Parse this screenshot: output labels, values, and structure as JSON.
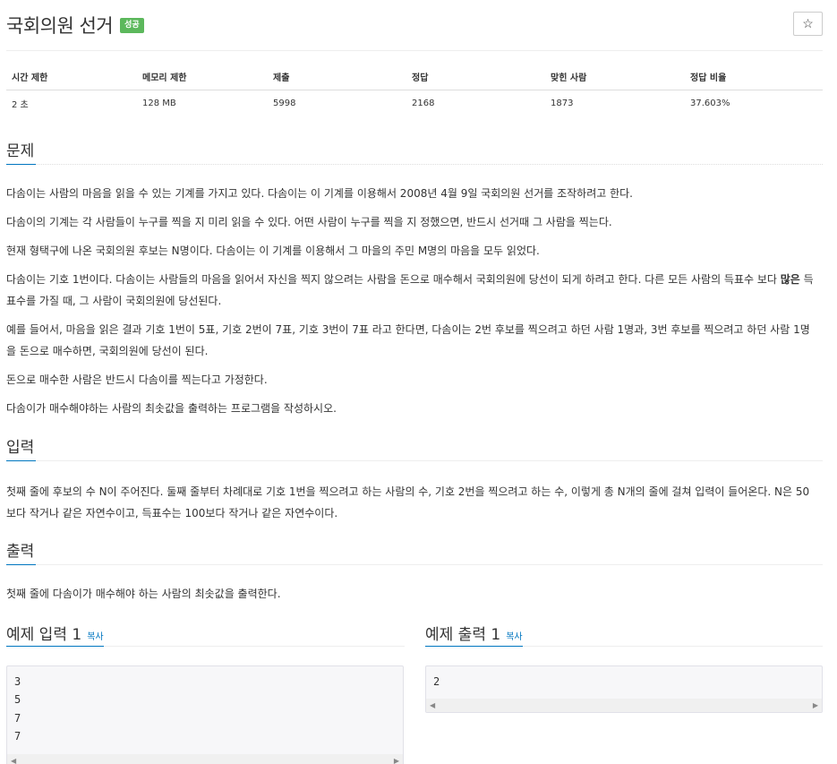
{
  "problem": {
    "title": "국회의원 선거",
    "badge": "성공",
    "star_icon": "☆"
  },
  "stats": {
    "headers": [
      "시간 제한",
      "메모리 제한",
      "제출",
      "정답",
      "맞힌 사람",
      "정답 비율"
    ],
    "values": [
      "2 초",
      "128 MB",
      "5998",
      "2168",
      "1873",
      "37.603%"
    ]
  },
  "sections": {
    "problem_title": "문제",
    "input_title": "입력",
    "output_title": "출력"
  },
  "description": {
    "p1": "다솜이는 사람의 마음을 읽을 수 있는 기계를 가지고 있다. 다솜이는 이 기계를 이용해서 2008년 4월 9일 국회의원 선거를 조작하려고 한다.",
    "p2": "다솜이의 기계는 각 사람들이 누구를 찍을 지 미리 읽을 수 있다. 어떤 사람이 누구를 찍을 지 정했으면, 반드시 선거때 그 사람을 찍는다.",
    "p3": "현재 형택구에 나온 국회의원 후보는 N명이다. 다솜이는 이 기계를 이용해서 그 마을의 주민 M명의 마음을 모두 읽었다.",
    "p4_a": "다솜이는 기호 1번이다. 다솜이는 사람들의 마음을 읽어서 자신을 찍지 않으려는 사람을 돈으로 매수해서 국회의원에 당선이 되게 하려고 한다. 다른 모든 사람의 득표수 보다 ",
    "p4_bold": "많은",
    "p4_b": " 득표수를 가질 때, 그 사람이 국회의원에 당선된다.",
    "p5": "예를 들어서, 마음을 읽은 결과 기호 1번이 5표, 기호 2번이 7표, 기호 3번이 7표 라고 한다면, 다솜이는 2번 후보를 찍으려고 하던 사람 1명과, 3번 후보를 찍으려고 하던 사람 1명을 돈으로 매수하면, 국회의원에 당선이 된다.",
    "p6": "돈으로 매수한 사람은 반드시 다솜이를 찍는다고 가정한다.",
    "p7": "다솜이가 매수해야하는 사람의 최솟값을 출력하는 프로그램을 작성하시오."
  },
  "input_text": "첫째 줄에 후보의 수 N이 주어진다. 둘째 줄부터 차례대로 기호 1번을 찍으려고 하는 사람의 수, 기호 2번을 찍으려고 하는 수, 이렇게 총 N개의 줄에 걸쳐 입력이 들어온다. N은 50보다 작거나 같은 자연수이고, 득표수는 100보다 작거나 같은 자연수이다.",
  "output_text": "첫째 줄에 다솜이가 매수해야 하는 사람의 최솟값을 출력한다.",
  "samples": {
    "input_title": "예제 입력 1",
    "output_title": "예제 출력 1",
    "copy_label": "복사",
    "input_value": "3\n5\n7\n7",
    "output_value": "2",
    "scroll_left_icon": "◀",
    "scroll_right_icon": "▶"
  }
}
